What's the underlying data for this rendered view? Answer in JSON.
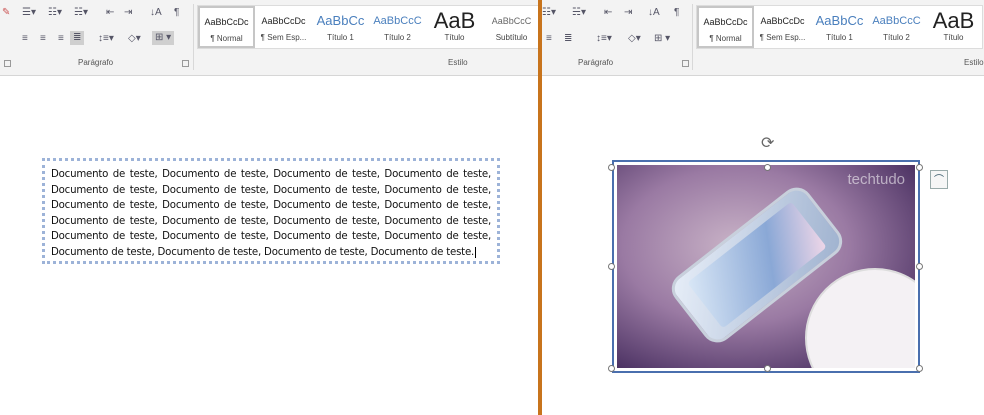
{
  "ribbon": {
    "paragraph_label": "Parágrafo",
    "style_label": "Estilo",
    "style_label_right": "Estilo",
    "styles": [
      {
        "preview": "AaBbCcDc",
        "name": "¶ Normal"
      },
      {
        "preview": "AaBbCcDc",
        "name": "¶ Sem Esp..."
      },
      {
        "preview": "AaBbCc",
        "name": "Título 1"
      },
      {
        "preview": "AaBbCcC",
        "name": "Título 2"
      },
      {
        "preview": "AaB",
        "name": "Título"
      },
      {
        "preview": "AaBbCcC",
        "name": "Subtítulo"
      }
    ]
  },
  "document": {
    "text": "Documento de teste, Documento de teste, Documento de teste, Documento de teste, Documento de teste, Documento de teste, Documento de teste, Documento de teste, Documento de teste, Documento de teste, Documento de teste, Documento de teste, Documento de teste, Documento de teste, Documento de teste, Documento de teste, Documento de teste, Documento de teste, Documento de teste, Documento de teste, Documento de teste, Documento de teste, Documento de teste, Documento de teste."
  },
  "image": {
    "watermark": "techtudo"
  },
  "colors": {
    "divider": "#c8741c",
    "selection": "#4a6fae"
  }
}
